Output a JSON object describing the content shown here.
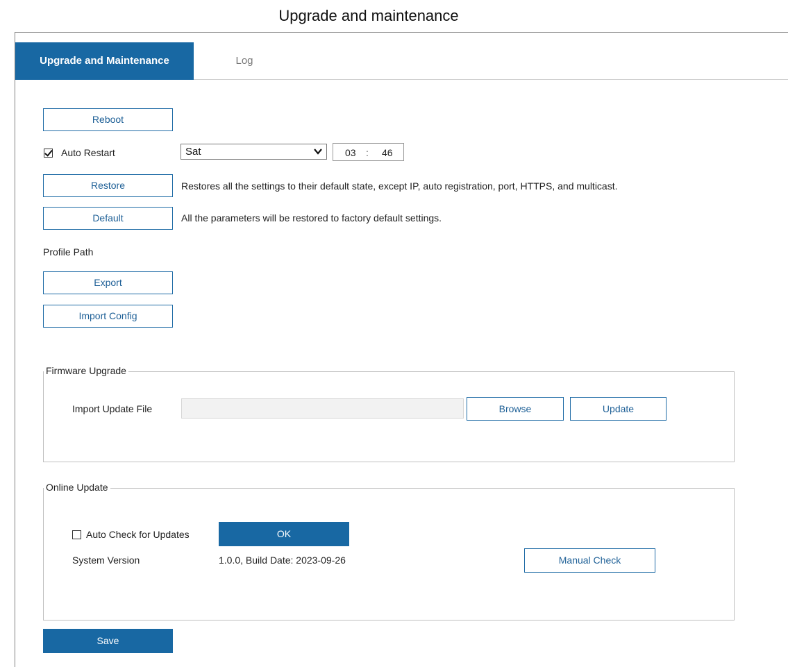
{
  "caption": "Upgrade and maintenance",
  "tabs": [
    {
      "label": "Upgrade and Maintenance",
      "active": true
    },
    {
      "label": "Log",
      "active": false
    }
  ],
  "maintenance": {
    "reboot_label": "Reboot",
    "auto_restart": {
      "label": "Auto Restart",
      "checked": true,
      "day": "Sat",
      "hour": "03",
      "separator": ":",
      "minute": "46"
    },
    "restore_label": "Restore",
    "restore_desc": "Restores all the settings to their default state, except IP, auto registration, port, HTTPS, and multicast.",
    "default_label": "Default",
    "default_desc": "All the parameters will be restored to factory default settings.",
    "profile_path_label": "Profile Path",
    "export_label": "Export",
    "import_config_label": "Import Config"
  },
  "firmware": {
    "legend": "Firmware Upgrade",
    "import_label": "Import Update File",
    "file_value": "",
    "browse_label": "Browse",
    "update_label": "Update"
  },
  "online_update": {
    "legend": "Online Update",
    "auto_check_label": "Auto Check for Updates",
    "auto_check_checked": false,
    "ok_label": "OK",
    "system_version_label": "System Version",
    "system_version_value": "1.0.0, Build Date: 2023-09-26",
    "manual_check_label": "Manual Check"
  },
  "save_label": "Save",
  "colors": {
    "accent": "#1868a3",
    "button_text": "#1d5f96",
    "tab_inactive": "#777777"
  }
}
